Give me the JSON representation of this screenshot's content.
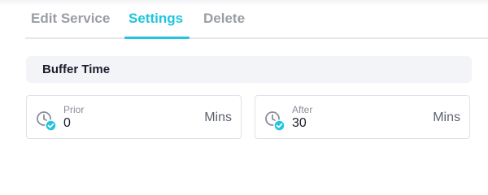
{
  "tabs": [
    {
      "label": "Edit Service",
      "active": false
    },
    {
      "label": "Settings",
      "active": true
    },
    {
      "label": "Delete",
      "active": false
    }
  ],
  "colors": {
    "accent": "#22c5dd",
    "tab_inactive": "#9a9da6",
    "section_bg": "#f3f4f8",
    "text_dark": "#1d1f2e"
  },
  "section": {
    "title": "Buffer Time"
  },
  "fields": {
    "prior": {
      "label": "Prior",
      "value": "0",
      "unit": "Mins",
      "icon": "clock-check-icon"
    },
    "after": {
      "label": "After",
      "value": "30",
      "unit": "Mins",
      "icon": "clock-check-icon"
    }
  }
}
